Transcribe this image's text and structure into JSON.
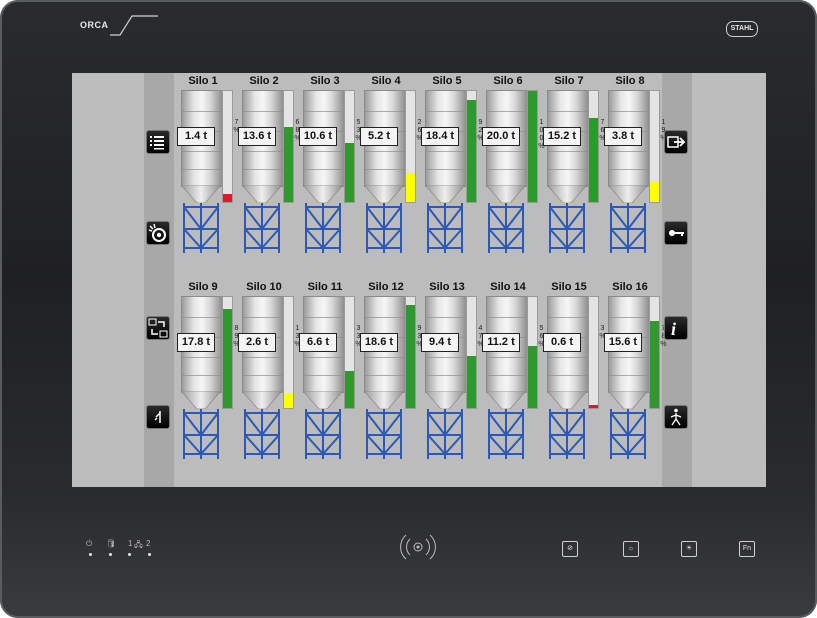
{
  "device": {
    "brand": "ORCA",
    "maker": "STAHL",
    "leds": [
      "⏻",
      "🛢",
      "1",
      "🖧",
      "2"
    ],
    "hw_buttons": [
      {
        "name": "screen-lock",
        "glyph": "⊘"
      },
      {
        "name": "brightness-down",
        "glyph": "☼"
      },
      {
        "name": "brightness-up",
        "glyph": "☀"
      },
      {
        "name": "fn",
        "glyph": "Fn"
      }
    ]
  },
  "silos": [
    {
      "name": "Silo 1",
      "weight": "1.4 t",
      "percent": "7",
      "fill": 7,
      "color": "#e0182d"
    },
    {
      "name": "Silo 2",
      "weight": "13.6 t",
      "percent": "68",
      "fill": 68,
      "color": "#2e9a2e"
    },
    {
      "name": "Silo 3",
      "weight": "10.6 t",
      "percent": "53",
      "fill": 53,
      "color": "#2e9a2e"
    },
    {
      "name": "Silo 4",
      "weight": "5.2 t",
      "percent": "26",
      "fill": 26,
      "color": "#ffff00"
    },
    {
      "name": "Silo 5",
      "weight": "18.4 t",
      "percent": "92",
      "fill": 92,
      "color": "#2e9a2e"
    },
    {
      "name": "Silo 6",
      "weight": "20.0 t",
      "percent": "100",
      "fill": 100,
      "color": "#2e9a2e"
    },
    {
      "name": "Silo 7",
      "weight": "15.2 t",
      "percent": "76",
      "fill": 76,
      "color": "#2e9a2e"
    },
    {
      "name": "Silo 8",
      "weight": "3.8 t",
      "percent": "19",
      "fill": 19,
      "color": "#ffff00"
    },
    {
      "name": "Silo 9",
      "weight": "17.8 t",
      "percent": "89",
      "fill": 89,
      "color": "#2e9a2e"
    },
    {
      "name": "Silo 10",
      "weight": "2.6 t",
      "percent": "13",
      "fill": 13,
      "color": "#ffff00"
    },
    {
      "name": "Silo 11",
      "weight": "6.6 t",
      "percent": "33",
      "fill": 33,
      "color": "#2e9a2e"
    },
    {
      "name": "Silo 12",
      "weight": "18.6 t",
      "percent": "93",
      "fill": 93,
      "color": "#2e9a2e"
    },
    {
      "name": "Silo 13",
      "weight": "9.4 t",
      "percent": "47",
      "fill": 47,
      "color": "#2e9a2e"
    },
    {
      "name": "Silo 14",
      "weight": "11.2 t",
      "percent": "56",
      "fill": 56,
      "color": "#2e9a2e"
    },
    {
      "name": "Silo 15",
      "weight": "0.6 t",
      "percent": "3",
      "fill": 3,
      "color": "#e0182d"
    },
    {
      "name": "Silo 16",
      "weight": "15.6 t",
      "percent": "78",
      "fill": 78,
      "color": "#2e9a2e"
    }
  ],
  "percent_sign": "%",
  "left_buttons": [
    {
      "name": "list-menu"
    },
    {
      "name": "camera-settings"
    },
    {
      "name": "swap-transfer"
    },
    {
      "name": "back-mark"
    }
  ],
  "right_buttons": [
    {
      "name": "logout"
    },
    {
      "name": "key-login"
    },
    {
      "name": "info"
    },
    {
      "name": "person-walk"
    }
  ],
  "colors": {
    "green": "#2e9a2e",
    "yellow": "#ffff00",
    "red": "#e0182d",
    "frame_blue": "#2b59b5"
  }
}
